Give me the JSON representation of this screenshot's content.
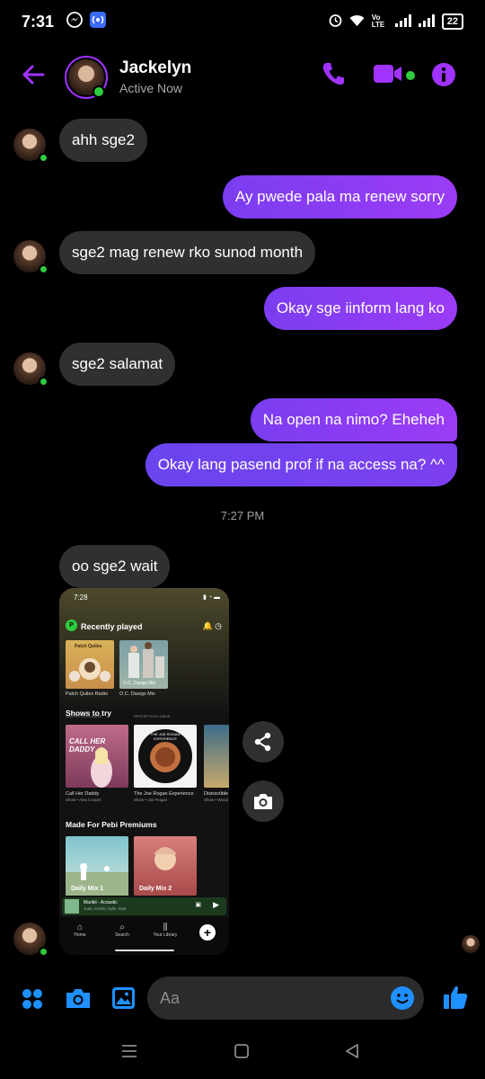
{
  "status_bar": {
    "time": "7:31",
    "network_label": "Vo LTE",
    "battery": "22"
  },
  "header": {
    "name": "Jackelyn",
    "status": "Active Now"
  },
  "messages": [
    {
      "dir": "in",
      "text": "ahh sge2"
    },
    {
      "dir": "out",
      "text": "Ay pwede pala ma renew sorry"
    },
    {
      "dir": "in",
      "text": "sge2 mag renew rko sunod month"
    },
    {
      "dir": "out",
      "text": "Okay sge iinform lang ko"
    },
    {
      "dir": "in",
      "text": "sge2 salamat"
    },
    {
      "dir": "out",
      "text": "Na open na nimo? Eheheh"
    },
    {
      "dir": "out",
      "text": "Okay lang pasend prof if na access na? ^^"
    },
    {
      "dir": "in",
      "text": "oo sge2 wait"
    }
  ],
  "timestamp": "7:27 PM",
  "shared_screenshot": {
    "time": "7:28",
    "recently_played": "Recently played",
    "tile1_top": "Patch Quiles",
    "tile1": "Patch Quiles Radio",
    "tile2": "O.C. Dawgs Mix",
    "shows_to_try": "Shows to try",
    "show1": "Call Her Daddy",
    "show1_sub": "Show • Alex Cooper",
    "show1_art": "CALL HER DADDY",
    "show2": "The Joe Rogan Experience",
    "show2_sub": "Show • Joe Rogan",
    "show2_art": "THE JOE ROGAN EXPERIENCE",
    "show3": "Distractible",
    "show3_sub": "Show • Wood",
    "made_for": "Made For Pebi Premiums",
    "mix1": "Daily Mix 1",
    "mix2": "Daily Mix 2",
    "now_playing": "Marikit - Acoustic",
    "now_playing_artist": "Juan, Cecile, Kyle, GaS",
    "nav_home": "Home",
    "nav_search": "Search",
    "nav_library": "Your Library",
    "badge": "SPOTIFY EXCLUSIVE"
  },
  "composer": {
    "placeholder": "Aa"
  },
  "colors": {
    "accent": "#9b3cf6",
    "incoming": "#303030",
    "online": "#2ecc40",
    "composer_icons": "#1e90ff"
  }
}
